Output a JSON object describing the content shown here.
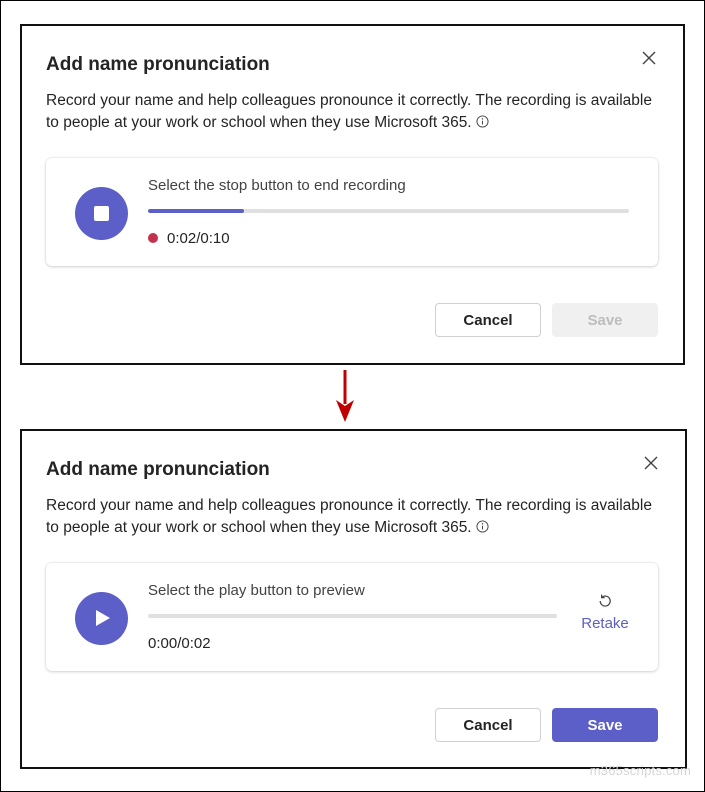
{
  "dialog_recording": {
    "title": "Add name pronunciation",
    "description": "Record your name and help colleagues pronounce it correctly. The recording is available to people at your work or school when they use Microsoft 365.",
    "card_label": "Select the stop button to end recording",
    "progress": 0.2,
    "time": "0:02/0:10",
    "cancel_label": "Cancel",
    "save_label": "Save",
    "save_enabled": false
  },
  "dialog_preview": {
    "title": "Add name pronunciation",
    "description": "Record your name and help colleagues pronounce it correctly. The recording is available to people at your work or school when they use Microsoft 365.",
    "card_label": "Select the play button to preview",
    "progress": 0.0,
    "time": "0:00/0:02",
    "retake_label": "Retake",
    "cancel_label": "Cancel",
    "save_label": "Save",
    "save_enabled": true
  },
  "colors": {
    "brand": "#5b5fc7",
    "recording_dot": "#c4314b",
    "arrow": "#c00000"
  },
  "watermark": "m365scripts.com"
}
